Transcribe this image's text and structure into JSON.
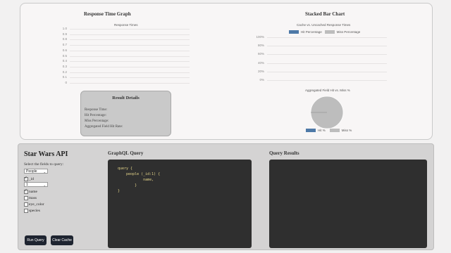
{
  "metrics": {
    "response_graph": {
      "title": "Response Time Graph",
      "chart_title": "Response Times",
      "y_ticks": [
        "1.0",
        "0.9",
        "0.8",
        "0.7",
        "0.6",
        "0.5",
        "0.4",
        "0.3",
        "0.2",
        "0.1",
        "0"
      ]
    },
    "stacked_bar": {
      "title": "Stacked Bar Chart",
      "chart_title": "Cache vs. Uncached Response Times",
      "legend": [
        "Hit Percentage",
        "Miss Percentage"
      ],
      "y_ticks": [
        "100%",
        "80%",
        "60%",
        "40%",
        "20%",
        "0%"
      ]
    },
    "pie": {
      "title": "Aggregated Field Hit vs. Miss %",
      "legend": [
        "Hit %",
        "Miss %"
      ]
    },
    "result_details": {
      "title": "Result Details",
      "lines": [
        "Response Time:",
        "Hit Percentage:",
        "Miss Percentage:",
        "Aggregated Field Hit Rate:"
      ]
    }
  },
  "api": {
    "title": "Star Wars API",
    "select_label": "Select the fields to query:",
    "type_select": "People",
    "id_label": "_id",
    "id_select": "1",
    "fields": [
      {
        "label": "name",
        "checked": true
      },
      {
        "label": "mass",
        "checked": false
      },
      {
        "label": "eye_color",
        "checked": false
      },
      {
        "label": "species",
        "checked": false
      }
    ],
    "run_button": "Run Query",
    "clear_button": "Clear Cache",
    "graphql_heading": "GraphQL Query",
    "results_heading": "Query Results",
    "code": [
      "query {",
      "    people (_id:1) {",
      "            name,",
      "        }",
      "}"
    ]
  },
  "chart_data": [
    {
      "type": "line",
      "title": "Response Times",
      "ylim": [
        0,
        1.0
      ],
      "series": [],
      "grid": true
    },
    {
      "type": "bar",
      "title": "Cache vs. Uncached Response Times",
      "ylim": [
        0,
        100
      ],
      "series": [
        {
          "name": "Hit Percentage",
          "values": []
        },
        {
          "name": "Miss Percentage",
          "values": []
        }
      ],
      "colors": [
        "#4e79a7",
        "#bdbdbd"
      ],
      "legend": "top"
    },
    {
      "type": "pie",
      "title": "Aggregated Field Hit vs. Miss %",
      "series": [
        {
          "name": "Hit %",
          "values": [
            0
          ]
        },
        {
          "name": "Miss %",
          "values": [
            100
          ]
        }
      ],
      "colors": [
        "#4e79a7",
        "#bdbdbd"
      ],
      "legend": "bottom"
    }
  ],
  "colors": {
    "hit": "#4e79a7",
    "miss": "#bdbdbd",
    "editor_bg": "#2f2f2f",
    "code": "#e6d68a",
    "button": "#1e2430"
  }
}
